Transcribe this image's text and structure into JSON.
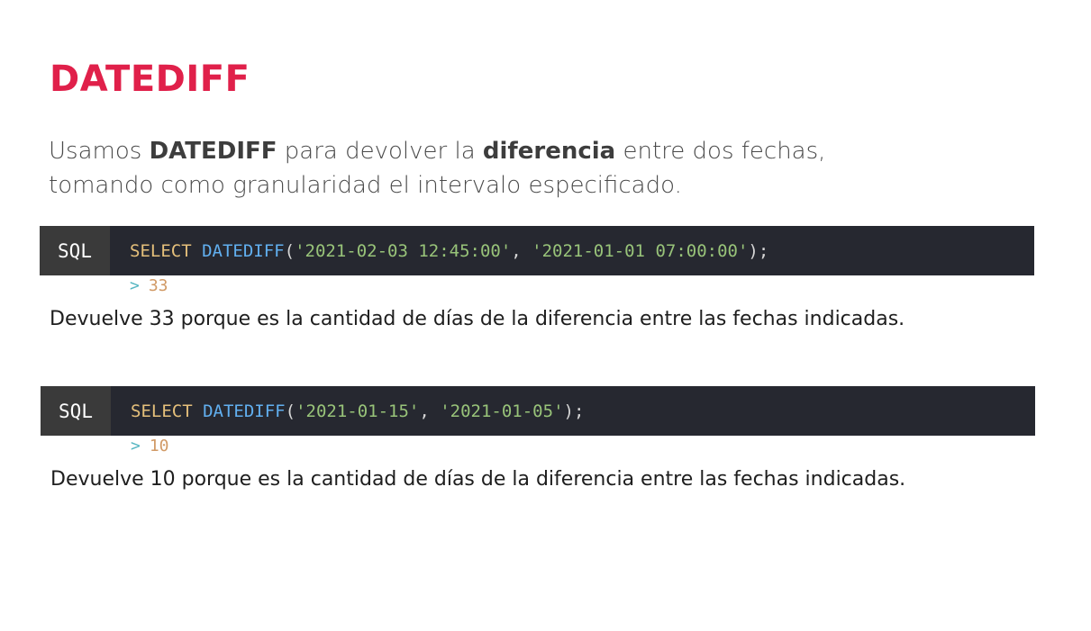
{
  "title": "DATEDIFF",
  "intro": {
    "line1_pre": "Usamos ",
    "line1_bold1": "DATEDIFF",
    "line1_mid": " para devolver la ",
    "line1_bold2": "diferencia",
    "line1_post": " entre dos fechas,",
    "line2": "tomando como granularidad el intervalo especificado."
  },
  "examples": [
    {
      "lang": "SQL",
      "keyword": "SELECT",
      "function": "DATEDIFF",
      "open_paren": "(",
      "arg1": "'2021-02-03 12:45:00'",
      "sep": ", ",
      "arg2": "'2021-01-01 07:00:00'",
      "close": ");",
      "result_arrow": ">",
      "result": "33",
      "explanation": "Devuelve 33 porque es la cantidad de días de la diferencia entre las fechas indicadas."
    },
    {
      "lang": "SQL",
      "keyword": "SELECT",
      "function": "DATEDIFF",
      "open_paren": "(",
      "arg1": "'2021-01-15'",
      "sep": ", ",
      "arg2": "'2021-01-05'",
      "close": ");",
      "result_arrow": ">",
      "result": "10",
      "explanation": "Devuelve 10 porque es la cantidad de días de la diferencia entre las fechas indicadas."
    }
  ],
  "colors": {
    "title": "#e0204a",
    "code_bg": "#262830",
    "lang_tag_bg": "#3a3a3a",
    "keyword": "#e5c07b",
    "function": "#61afef",
    "string": "#98c379",
    "result_arrow": "#56b6c2",
    "result_number": "#d19a66"
  }
}
